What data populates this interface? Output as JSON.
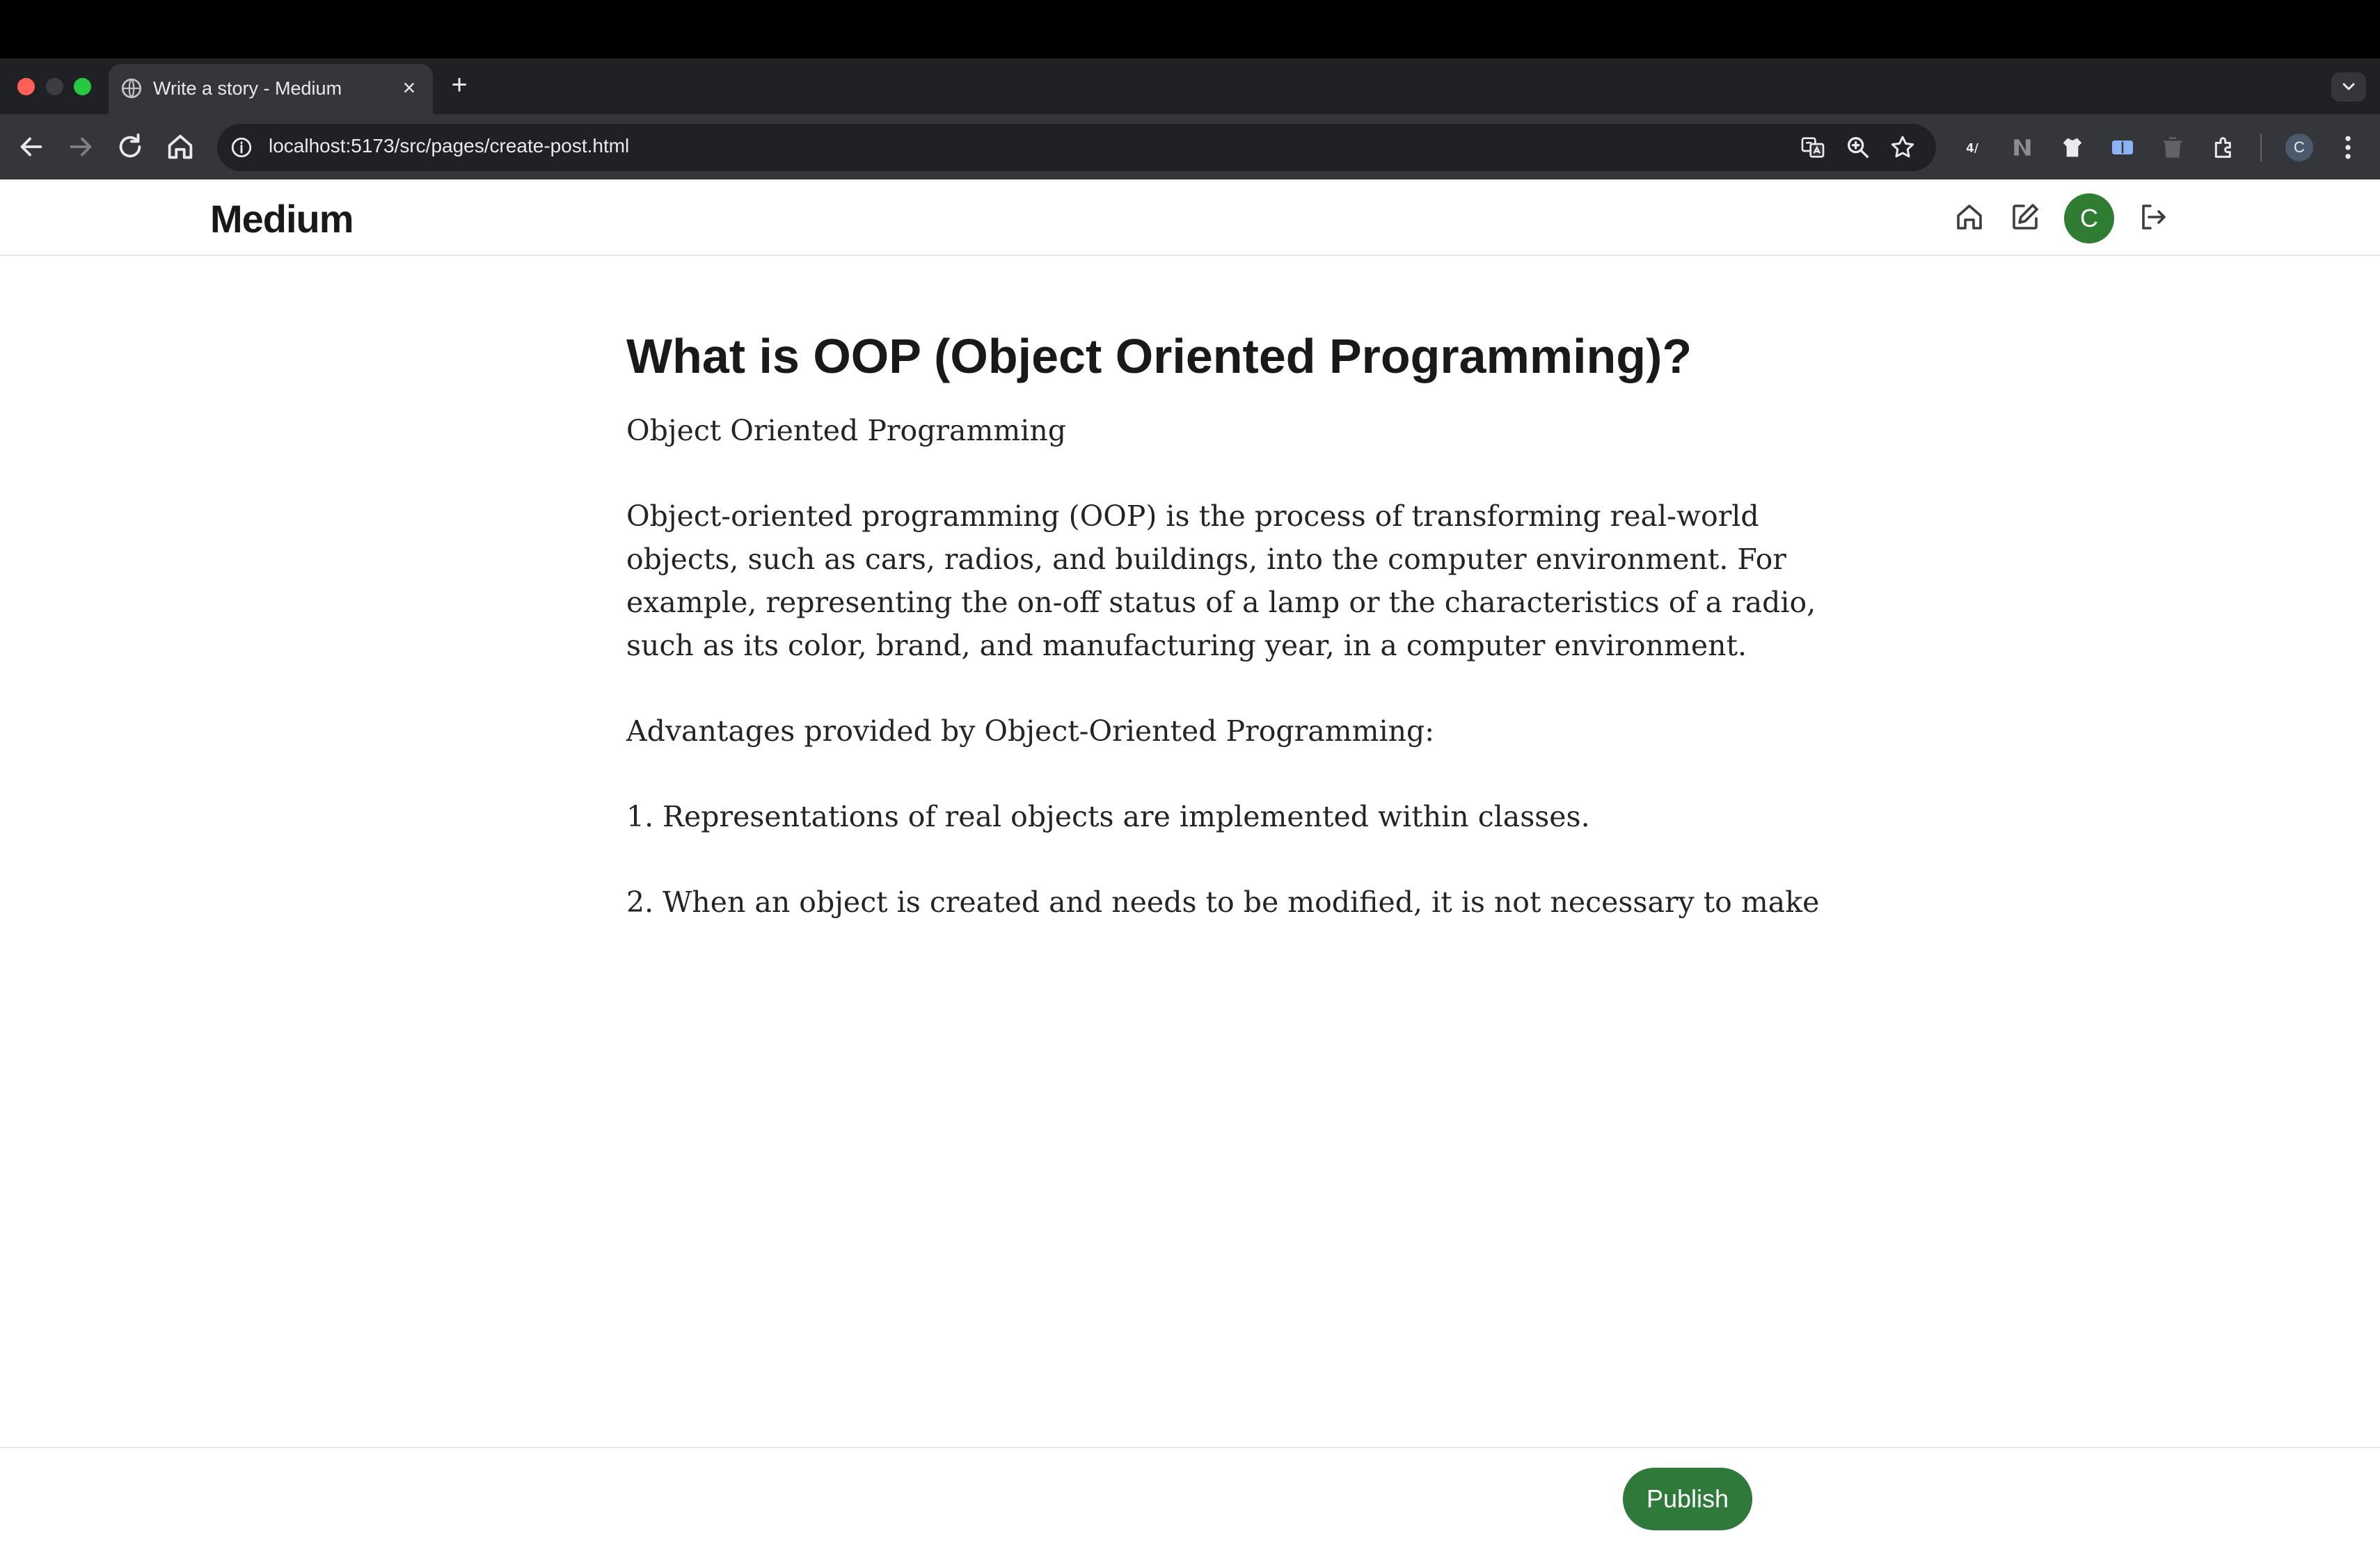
{
  "browser": {
    "tab_title": "Write a story - Medium",
    "new_tab_label": "+",
    "close_label": "×",
    "url": "localhost:5173/src/pages/create-post.html",
    "profile_initial": "C"
  },
  "site": {
    "logo": "Medium",
    "avatar_initial": "C",
    "icons": [
      "home-icon",
      "edit-icon",
      "logout-icon"
    ]
  },
  "post": {
    "title": "What is OOP (Object Oriented Programming)?",
    "subtitle": "Object Oriented Programming",
    "paragraph_lines": [
      "Object-oriented programming (OOP) is the process of transforming real-world",
      "objects, such as cars, radios, and buildings, into the computer environment. For",
      "example, representing the on-off status of a lamp or the characteristics of a radio,",
      "such as its color, brand, and manufacturing year, in a computer environment."
    ],
    "advantages_heading": "Advantages provided by Object-Oriented Programming:",
    "item_1": "1. Representations of real objects are implemented within classes.",
    "item_2": "2. When an object is created and needs to be modified, it is not necessary to make"
  },
  "footer": {
    "publish_label": "Publish"
  },
  "colors": {
    "accent_green": "#2e7d32",
    "publish_green": "#2f7a3b",
    "chrome_dark": "#202124",
    "chrome_toolbar": "#35363a"
  }
}
